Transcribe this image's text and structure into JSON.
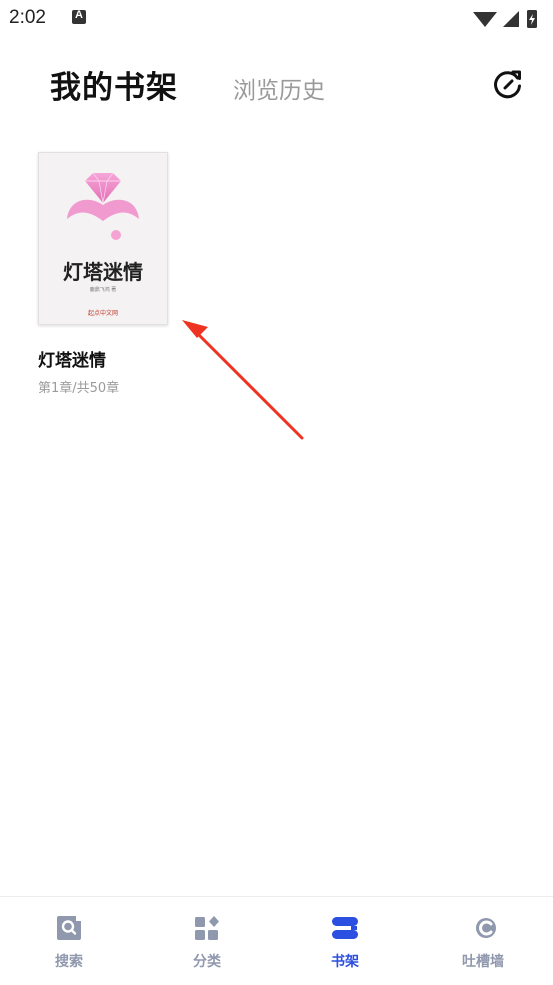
{
  "status_bar": {
    "time": "2:02",
    "notification_letter": "A"
  },
  "header": {
    "tabs": [
      {
        "label": "我的书架",
        "active": true
      },
      {
        "label": "浏览历史",
        "active": false
      }
    ],
    "refresh_icon": "refresh-icon"
  },
  "books": [
    {
      "cover_title": "灯塔迷情",
      "cover_author": "鹿鼎飞鸿 著",
      "cover_publisher": "起点中文网",
      "title": "灯塔迷情",
      "progress": "第1章/共50章"
    }
  ],
  "bottom_nav": {
    "items": [
      {
        "label": "搜索",
        "icon": "search-icon",
        "active": false
      },
      {
        "label": "分类",
        "icon": "category-icon",
        "active": false
      },
      {
        "label": "书架",
        "icon": "bookshelf-icon",
        "active": true
      },
      {
        "label": "吐槽墙",
        "icon": "chat-wall-icon",
        "active": false
      }
    ]
  },
  "colors": {
    "accent": "#2b4fe0",
    "inactive": "#8f98ad",
    "annotation": "#ee3322"
  }
}
